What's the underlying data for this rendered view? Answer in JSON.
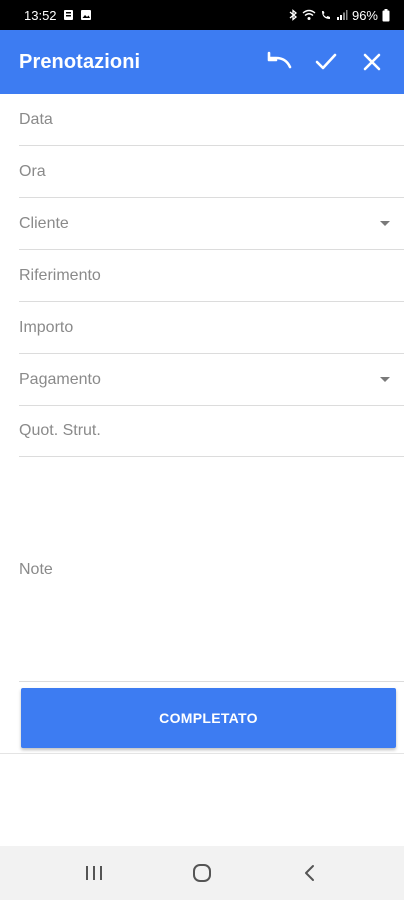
{
  "status_bar": {
    "time": "13:52",
    "battery": "96%",
    "left_icons": [
      "sim-card-icon",
      "gallery-icon"
    ],
    "right_icons": [
      "bluetooth-icon",
      "wifi-icon",
      "wifi-call-icon",
      "signal-icon",
      "battery-icon"
    ]
  },
  "app_bar": {
    "title": "Prenotazioni",
    "actions": [
      "undo-icon",
      "check-icon",
      "close-icon"
    ],
    "color": "#3d7cf2"
  },
  "form": {
    "fields": [
      {
        "label": "Data",
        "dropdown": false
      },
      {
        "label": "Ora",
        "dropdown": false
      },
      {
        "label": "Cliente",
        "dropdown": true
      },
      {
        "label": "Riferimento",
        "dropdown": false
      },
      {
        "label": "Importo",
        "dropdown": false
      },
      {
        "label": "Pagamento",
        "dropdown": true
      },
      {
        "label": "Quot. Strut.",
        "dropdown": false
      }
    ],
    "note_label": "Note"
  },
  "complete_button": {
    "label": "COMPLETATO"
  },
  "nav_bar": {
    "buttons": [
      "recent-apps-icon",
      "home-icon",
      "back-icon"
    ]
  }
}
